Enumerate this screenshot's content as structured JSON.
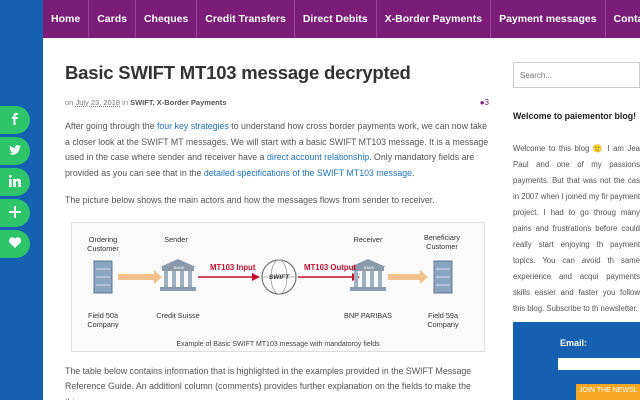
{
  "nav": {
    "items": [
      "Home",
      "Cards",
      "Cheques",
      "Credit Transfers",
      "Direct Debits",
      "X-Border Payments",
      "Payment messages",
      "Contact"
    ]
  },
  "share": {
    "icons": [
      "facebook-icon",
      "twitter-icon",
      "linkedin-icon",
      "plus-icon",
      "heart-icon"
    ],
    "color": "#2ec46a"
  },
  "post": {
    "title": "Basic SWIFT MT103 message decrypted",
    "meta_on": "on",
    "date": "July 23, 2018",
    "meta_in": "in",
    "categories": "SWIFT, X-Border Payments",
    "comment_count": "3",
    "p1_a": "After going through the ",
    "p1_link1": "four key strategies",
    "p1_b": " to understand how cross border payments work, we can now take a closer look at the SWIFT MT messages. We will start with a basic SWIFT MT103 message. It is a message used in the case where sender and receiver have a ",
    "p1_link2": "direct account relationship",
    "p1_c": ". Only mandatory fields are provided as you can see that in the ",
    "p1_link3": "detailed specifications of the SWIFT MT103 message",
    "p1_d": ".",
    "p2": "The picture below shows the main actors and how the messages flows from sender to receiver.",
    "p3": "The table below contains information that is highlighted in the examples provided in the SWIFT Message Reference Guide. An additionl column (comments) provides further explanation on the fields to make the things"
  },
  "figure": {
    "ordering_customer": "Ordering\nCustomer",
    "sender": "Sender",
    "receiver": "Receiver",
    "beneficiary_customer": "Beneficiary\nCustomer",
    "mt103_input": "MT103 Input",
    "mt103_output": "MT103 Output",
    "swift": "SWIFT",
    "field_50a": "Field 50a\nCompany",
    "credit_suisse": "Credit Suisse",
    "bnp": "BNP PARIBAS",
    "field_59a": "Field 59a\nCompany",
    "bank_label": "BANK",
    "caption": "Example of Basic SWIFT MT103 message with mandatoroy fields"
  },
  "sidebar": {
    "search_placeholder": "Search...",
    "welcome_title": "Welcome to paiementor blog!",
    "welcome_text": "Welcome to this blog 🙂 I am Jea Paul and one of my passions payments. But that was not the cas in 2007 when I joined my fir payment project. I had to go throug many pains and frustrations before could really start enjoying th payment topics. You can avoid th same experience and acqui payments skills easier and faster you follow this blog. Subscribe to th newsletter.",
    "email_label": "Email:",
    "join_button": "JOIN THE NEWSL"
  },
  "colors": {
    "nav_bg": "#7b1c79",
    "link": "#1e73be",
    "page_bg": "#1560b0",
    "button": "#f5a623"
  }
}
